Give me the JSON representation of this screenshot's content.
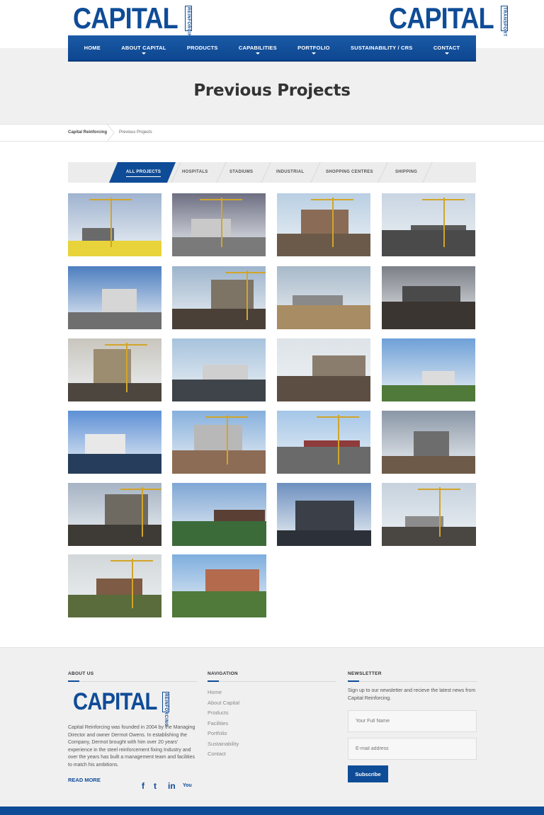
{
  "header": {
    "logo_left": {
      "word": "CAPITAL",
      "side": "REINFORCING"
    },
    "logo_right": {
      "word": "CAPITAL",
      "side": "TRANSPORT"
    }
  },
  "nav": {
    "items": [
      {
        "label": "HOME"
      },
      {
        "label": "ABOUT CAPITAL"
      },
      {
        "label": "PRODUCTS"
      },
      {
        "label": "CAPABILITIES"
      },
      {
        "label": "PORTFOLIO"
      },
      {
        "label": "SUSTAINABILITY / CRS"
      },
      {
        "label": "CONTACT"
      }
    ]
  },
  "page": {
    "title": "Previous Projects"
  },
  "breadcrumb": {
    "home": "Capital Reinforcing",
    "current": "Previous Projects"
  },
  "filters": {
    "tabs": [
      "ALL PROJECTS",
      "HOSPITALS",
      "STADIUMS",
      "INDUSTRIAL",
      "SHOPPING CENTRES",
      "SHIPPING"
    ],
    "active": "ALL PROJECTS"
  },
  "projects_count": 22,
  "footer": {
    "about": {
      "heading": "ABOUT US",
      "logo_word": "CAPITAL",
      "logo_side": "REINFORCING",
      "text": "Capital Reinforcing was founded in 2004 by the Managing Director and owner Dermot Owens. In establishing the Company, Dermot brought with him over 20 years' experience in the steel reinforcement fixing Industry and over the years has built a management team and facilities to match his ambitions.",
      "read_more": "READ MORE"
    },
    "social": {
      "facebook": "f",
      "twitter": "t",
      "linkedin": "in",
      "youtube": "You"
    },
    "navigation": {
      "heading": "NAVIGATION",
      "links": [
        "Home",
        "About Capital",
        "Products",
        "Facilities",
        "Portfolio",
        "Sustainability",
        "Contact"
      ]
    },
    "newsletter": {
      "heading": "NEWSLETTER",
      "text": "Sign up to our newsletter and recieve the latest news from Capital Reinforcing.",
      "name_placeholder": "Your Full Name",
      "email_placeholder": "E-mail address",
      "subscribe": "Subscribe"
    }
  },
  "colors": {
    "brand": "#0f4c97",
    "band": "#f0f0f0"
  }
}
